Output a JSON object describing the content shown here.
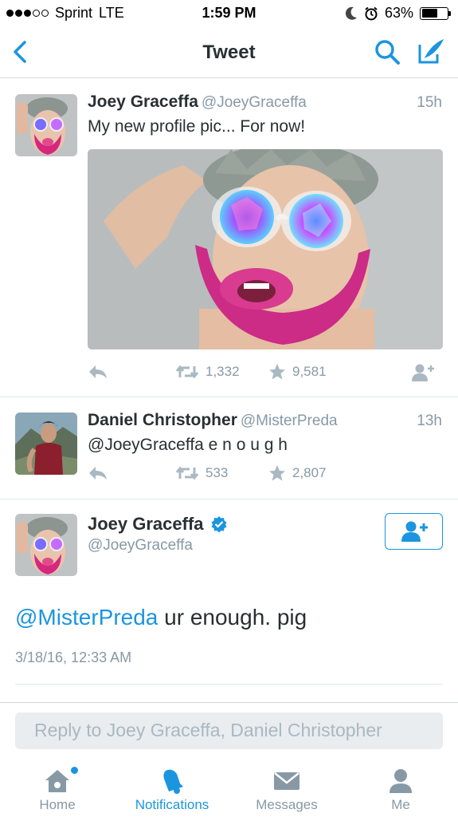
{
  "status_bar": {
    "carrier": "Sprint",
    "network": "LTE",
    "time": "1:59 PM",
    "battery": "63%",
    "battery_level": 0.63,
    "signal_bars_filled": 3,
    "signal_bars_total": 5
  },
  "nav": {
    "title": "Tweet",
    "back_icon": "chevron-left-icon",
    "search_icon": "search-icon",
    "compose_icon": "compose-icon"
  },
  "tweets": [
    {
      "name": "Joey Graceffa",
      "handle": "@JoeyGraceffa",
      "time": "15h",
      "text": "My new profile pic... For now!",
      "retweets": "1,332",
      "likes": "9,581"
    },
    {
      "name": "Daniel Christopher",
      "handle": "@MisterPreda",
      "time": "13h",
      "text": "@JoeyGraceffa e n o u g h",
      "retweets": "533",
      "likes": "2,807"
    }
  ],
  "main_tweet": {
    "name": "Joey Graceffa",
    "handle": "@JoeyGraceffa",
    "mention": "@MisterPreda",
    "text": " ur enough. pig",
    "date": "3/18/16, 12:33 AM"
  },
  "reply": {
    "placeholder": "Reply to Joey Graceffa, Daniel Christopher"
  },
  "tabs": [
    {
      "label": "Home",
      "icon": "home-icon",
      "active": false
    },
    {
      "label": "Notifications",
      "icon": "bell-icon",
      "active": true
    },
    {
      "label": "Messages",
      "icon": "envelope-icon",
      "active": false
    },
    {
      "label": "Me",
      "icon": "person-icon",
      "active": false
    }
  ],
  "colors": {
    "accent": "#1b95e0",
    "muted": "#8899a6",
    "icon_gray": "#aab8c2",
    "text": "#292f33"
  }
}
